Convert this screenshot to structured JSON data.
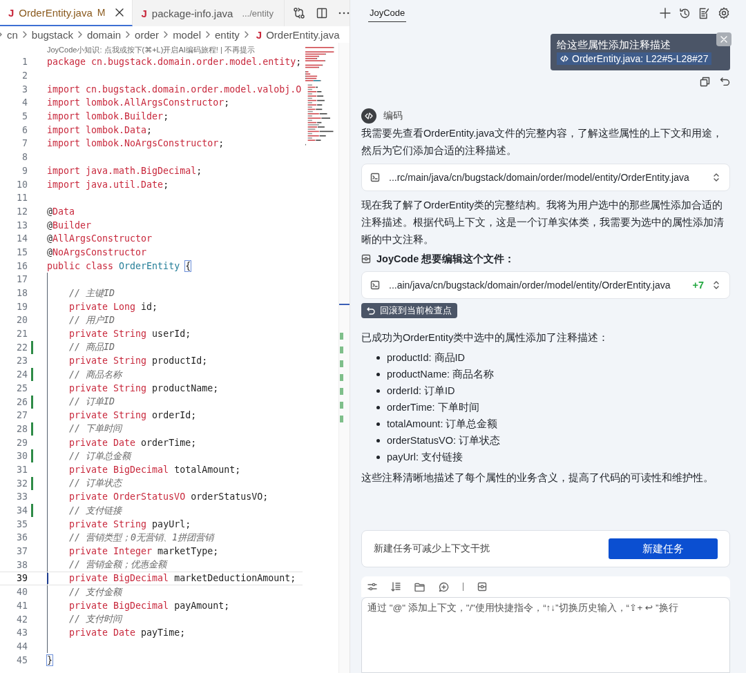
{
  "editor": {
    "tabs": [
      {
        "icon": "J",
        "label": "OrderEntity.java",
        "badge": "M",
        "closable": true,
        "selected": true
      },
      {
        "icon": "J",
        "label": "package-info.java",
        "description": ".../entity",
        "closable": false,
        "selected": false
      }
    ],
    "breadcrumbs": [
      {
        "kind": "folder",
        "label": "cn"
      },
      {
        "kind": "folder",
        "label": "bugstack"
      },
      {
        "kind": "folder",
        "label": "domain"
      },
      {
        "kind": "folder",
        "label": "order"
      },
      {
        "kind": "folder",
        "label": "model"
      },
      {
        "kind": "folder",
        "label": "entity"
      },
      {
        "kind": "file",
        "icon": "J",
        "label": "OrderEntity.java"
      }
    ],
    "hint": "JoyCode小知识: 点我或按下(⌘+L)开启AI编码旅程! | 不再提示",
    "lines": [
      {
        "number": "1",
        "modified": false,
        "current": false,
        "tokens": [
          {
            "kind": "kw",
            "text": "package cn.bugstack.domain.order.model.entity"
          },
          {
            "kind": "id",
            "text": ";"
          }
        ]
      },
      {
        "number": "2",
        "modified": false,
        "current": false
      },
      {
        "number": "3",
        "modified": false,
        "current": false,
        "tokens": [
          {
            "kind": "kw",
            "text": "import cn.bugstack.domain.order.model.valobj.O"
          }
        ]
      },
      {
        "number": "4",
        "modified": false,
        "current": false,
        "tokens": [
          {
            "kind": "kw",
            "text": "import lombok.AllArgsConstructor"
          },
          {
            "kind": "id",
            "text": ";"
          }
        ]
      },
      {
        "number": "5",
        "modified": false,
        "current": false,
        "tokens": [
          {
            "kind": "kw",
            "text": "import lombok.Builder"
          },
          {
            "kind": "id",
            "text": ";"
          }
        ]
      },
      {
        "number": "6",
        "modified": false,
        "current": false,
        "tokens": [
          {
            "kind": "kw",
            "text": "import lombok.Data"
          },
          {
            "kind": "id",
            "text": ";"
          }
        ]
      },
      {
        "number": "7",
        "modified": false,
        "current": false,
        "tokens": [
          {
            "kind": "kw",
            "text": "import lombok.NoArgsConstructor"
          },
          {
            "kind": "id",
            "text": ";"
          }
        ]
      },
      {
        "number": "8",
        "modified": false,
        "current": false
      },
      {
        "number": "9",
        "modified": false,
        "current": false,
        "tokens": [
          {
            "kind": "kw",
            "text": "import java.math.BigDecimal"
          },
          {
            "kind": "id",
            "text": ";"
          }
        ]
      },
      {
        "number": "10",
        "modified": false,
        "current": false,
        "tokens": [
          {
            "kind": "kw",
            "text": "import java.util.Date"
          },
          {
            "kind": "id",
            "text": ";"
          }
        ]
      },
      {
        "number": "11",
        "modified": false,
        "current": false
      },
      {
        "number": "12",
        "modified": false,
        "current": false,
        "tokens": [
          {
            "kind": "id",
            "text": "@"
          },
          {
            "kind": "kw",
            "text": "Data"
          }
        ]
      },
      {
        "number": "13",
        "modified": false,
        "current": false,
        "tokens": [
          {
            "kind": "id",
            "text": "@"
          },
          {
            "kind": "kw",
            "text": "Builder"
          }
        ]
      },
      {
        "number": "14",
        "modified": false,
        "current": false,
        "tokens": [
          {
            "kind": "id",
            "text": "@"
          },
          {
            "kind": "kw",
            "text": "AllArgsConstructor"
          }
        ]
      },
      {
        "number": "15",
        "modified": false,
        "current": false,
        "tokens": [
          {
            "kind": "id",
            "text": "@"
          },
          {
            "kind": "kw",
            "text": "NoArgsConstructor"
          }
        ]
      },
      {
        "number": "16",
        "modified": false,
        "current": false,
        "tokens": [
          {
            "kind": "kw",
            "text": "public class "
          },
          {
            "kind": "cls",
            "text": "OrderEntity"
          },
          {
            "kind": "open",
            "text": "{"
          }
        ]
      },
      {
        "number": "17",
        "modified": false,
        "current": false
      },
      {
        "number": "18",
        "modified": false,
        "current": false,
        "tokens": [
          {
            "kind": "cm",
            "text": "    // 主键ID"
          }
        ]
      },
      {
        "number": "19",
        "modified": false,
        "current": false,
        "tokens": [
          {
            "kind": "kw",
            "text": "    private Long"
          },
          {
            "kind": "id",
            "text": " id;"
          }
        ]
      },
      {
        "number": "20",
        "modified": false,
        "current": false,
        "tokens": [
          {
            "kind": "cm",
            "text": "    // 用户ID"
          }
        ]
      },
      {
        "number": "21",
        "modified": false,
        "current": false,
        "tokens": [
          {
            "kind": "kw",
            "text": "    private String"
          },
          {
            "kind": "id",
            "text": " userId;"
          }
        ]
      },
      {
        "number": "22",
        "modified": true,
        "current": false,
        "tokens": [
          {
            "kind": "cm",
            "text": "    // 商品ID"
          }
        ]
      },
      {
        "number": "23",
        "modified": false,
        "current": false,
        "tokens": [
          {
            "kind": "kw",
            "text": "    private String"
          },
          {
            "kind": "id",
            "text": " productId;"
          }
        ]
      },
      {
        "number": "24",
        "modified": true,
        "current": false,
        "tokens": [
          {
            "kind": "cm",
            "text": "    // 商品名称"
          }
        ]
      },
      {
        "number": "25",
        "modified": false,
        "current": false,
        "tokens": [
          {
            "kind": "kw",
            "text": "    private String"
          },
          {
            "kind": "id",
            "text": " productName;"
          }
        ]
      },
      {
        "number": "26",
        "modified": true,
        "current": false,
        "tokens": [
          {
            "kind": "cm",
            "text": "    // 订单ID"
          }
        ]
      },
      {
        "number": "27",
        "modified": false,
        "current": false,
        "tokens": [
          {
            "kind": "kw",
            "text": "    private String"
          },
          {
            "kind": "id",
            "text": " orderId;"
          }
        ]
      },
      {
        "number": "28",
        "modified": true,
        "current": false,
        "tokens": [
          {
            "kind": "cm",
            "text": "    // 下单时间"
          }
        ]
      },
      {
        "number": "29",
        "modified": false,
        "current": false,
        "tokens": [
          {
            "kind": "kw",
            "text": "    private Date"
          },
          {
            "kind": "id",
            "text": " orderTime;"
          }
        ]
      },
      {
        "number": "30",
        "modified": true,
        "current": false,
        "tokens": [
          {
            "kind": "cm",
            "text": "    // 订单总金额"
          }
        ]
      },
      {
        "number": "31",
        "modified": false,
        "current": false,
        "tokens": [
          {
            "kind": "kw",
            "text": "    private BigDecimal"
          },
          {
            "kind": "id",
            "text": " totalAmount;"
          }
        ]
      },
      {
        "number": "32",
        "modified": true,
        "current": false,
        "tokens": [
          {
            "kind": "cm",
            "text": "    // 订单状态"
          }
        ]
      },
      {
        "number": "33",
        "modified": false,
        "current": false,
        "tokens": [
          {
            "kind": "kw",
            "text": "    private OrderStatusVO"
          },
          {
            "kind": "id",
            "text": " orderStatusVO;"
          }
        ]
      },
      {
        "number": "34",
        "modified": true,
        "current": false,
        "tokens": [
          {
            "kind": "cm",
            "text": "    // 支付链接"
          }
        ]
      },
      {
        "number": "35",
        "modified": false,
        "current": false,
        "tokens": [
          {
            "kind": "kw",
            "text": "    private String"
          },
          {
            "kind": "id",
            "text": " payUrl;"
          }
        ]
      },
      {
        "number": "36",
        "modified": false,
        "current": false,
        "tokens": [
          {
            "kind": "cm",
            "text": "    // 营销类型；0无营销、1拼团营销"
          }
        ]
      },
      {
        "number": "37",
        "modified": false,
        "current": false,
        "tokens": [
          {
            "kind": "kw",
            "text": "    private Integer"
          },
          {
            "kind": "id",
            "text": " marketType;"
          }
        ]
      },
      {
        "number": "38",
        "modified": false,
        "current": false,
        "tokens": [
          {
            "kind": "cm",
            "text": "    // 营销金额；优惠金额"
          }
        ]
      },
      {
        "number": "39",
        "modified": false,
        "current": true,
        "tokens": [
          {
            "kind": "kw",
            "text": "    private BigDecimal"
          },
          {
            "kind": "id",
            "text": " marketDeductionAmount;"
          }
        ]
      },
      {
        "number": "40",
        "modified": false,
        "current": false,
        "tokens": [
          {
            "kind": "cm",
            "text": "    // 支付金额"
          }
        ]
      },
      {
        "number": "41",
        "modified": false,
        "current": false,
        "tokens": [
          {
            "kind": "kw",
            "text": "    private BigDecimal"
          },
          {
            "kind": "id",
            "text": " payAmount;"
          }
        ]
      },
      {
        "number": "42",
        "modified": false,
        "current": false,
        "tokens": [
          {
            "kind": "cm",
            "text": "    // 支付时间"
          }
        ]
      },
      {
        "number": "43",
        "modified": false,
        "current": false,
        "tokens": [
          {
            "kind": "kw",
            "text": "    private Date"
          },
          {
            "kind": "id",
            "text": " payTime;"
          }
        ]
      },
      {
        "number": "44",
        "modified": false,
        "current": false
      },
      {
        "number": "45",
        "modified": false,
        "current": false,
        "tokens": [
          {
            "kind": "close",
            "text": "}"
          }
        ]
      }
    ]
  },
  "chat": {
    "tabs": [
      {
        "label": "JoyCode",
        "selected": true
      }
    ],
    "user_message": {
      "text": "给这些属性添加注释描述",
      "reference": "OrderEntity.java: L22#5-L28#27"
    },
    "assistant": {
      "mode": "编码",
      "blocks": [
        {
          "kind": "paragraph",
          "text": "我需要先查看OrderEntity.java文件的完整内容，了解这些属性的上下文和用途，然后为它们添加合适的注释描述。"
        },
        {
          "kind": "file",
          "path": "...rc/main/java/cn/bugstack/domain/order/model/entity/OrderEntity.java"
        },
        {
          "kind": "paragraph",
          "text": "现在我了解了OrderEntity类的完整结构。我将为用户选中的那些属性添加合适的注释描述。根据代码上下文，这是一个订单实体类，我需要为选中的属性添加清晰的中文注释。"
        },
        {
          "kind": "heading",
          "text": "JoyCode 想要编辑这个文件："
        },
        {
          "kind": "file",
          "path": "...ain/java/cn/bugstack/domain/order/model/entity/OrderEntity.java",
          "added": "+7"
        },
        {
          "kind": "rollback",
          "text": "回滚到当前检查点"
        },
        {
          "kind": "paragraph",
          "text": "已成功为OrderEntity类中选中的属性添加了注释描述："
        },
        {
          "kind": "list",
          "items": [
            "productId: 商品ID",
            "productName: 商品名称",
            "orderId: 订单ID",
            "orderTime: 下单时间",
            "totalAmount: 订单总金额",
            "orderStatusVO: 订单状态",
            "payUrl: 支付链接"
          ]
        },
        {
          "kind": "paragraph",
          "text": "这些注释清晰地描述了每个属性的业务含义，提高了代码的可读性和维护性。"
        }
      ]
    },
    "new_task": {
      "text": "新建任务可减少上下文干扰",
      "button": "新建任务"
    },
    "input": {
      "placeholder": "通过 \"@\" 添加上下文，\"/\"使用快捷指令，“↑↓”切换历史输入，“⇧+ ↩ ”换行"
    }
  }
}
